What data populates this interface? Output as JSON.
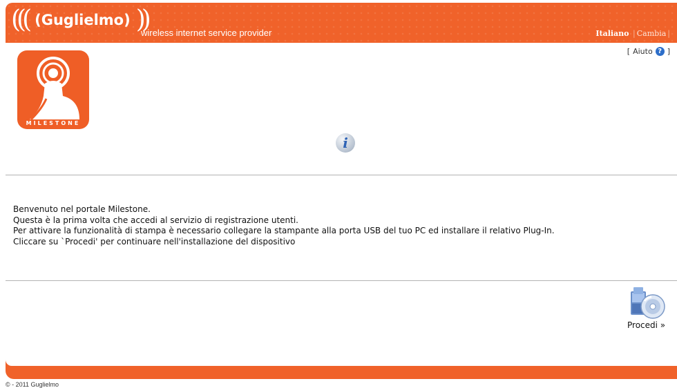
{
  "header": {
    "brand_name": "(Guglielmo)",
    "tagline": "wireless internet service provider",
    "language": {
      "current": "Italiano",
      "change_label": "Cambia"
    }
  },
  "help": {
    "open_bracket": "[",
    "label": "Aiuto",
    "close_bracket": "]"
  },
  "logo": {
    "word": "MILESTONE"
  },
  "message": {
    "lines": [
      "Benvenuto nel portale Milestone.",
      "Questa è la prima volta che accedi al servizio di registrazione utenti.",
      "Per attivare la funzionalità di stampa è necessario collegare la stampante alla porta USB del tuo PC ed installare il relativo Plug-In.",
      "Cliccare su `Procedi' per continuare nell'installazione del dispositivo"
    ]
  },
  "actions": {
    "proceed_label": "Procedi »"
  },
  "footer": {
    "copyright": "© - 2011 Guglielmo"
  },
  "colors": {
    "brand_orange": "#f0622a",
    "help_blue": "#2d6ec9"
  }
}
